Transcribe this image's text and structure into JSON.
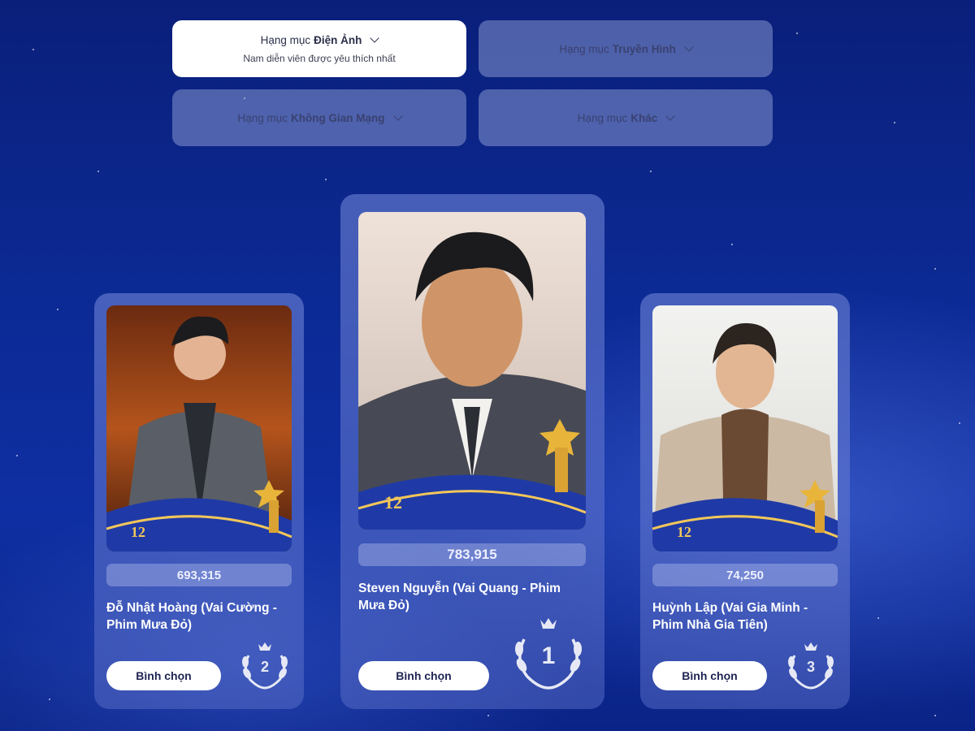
{
  "categories": [
    {
      "prefix": "Hạng mục",
      "name": "Điện Ảnh",
      "subtitle": "Nam diễn viên được yêu thích nhất",
      "active": true
    },
    {
      "prefix": "Hạng mục",
      "name": "Truyền Hình",
      "active": false
    },
    {
      "prefix": "Hạng mục",
      "name": "Không Gian Mạng",
      "active": false
    },
    {
      "prefix": "Hạng mục",
      "name": "Khác",
      "active": false
    }
  ],
  "nominees": [
    {
      "rank": "2",
      "votes": "693,315",
      "name": "Đỗ Nhật Hoàng (Vai Cường - Phim Mưa Đỏ)",
      "vote_label": "Bình chọn"
    },
    {
      "rank": "1",
      "votes": "783,915",
      "name": "Steven Nguyễn (Vai Quang - Phim Mưa Đỏ)",
      "vote_label": "Bình chọn"
    },
    {
      "rank": "3",
      "votes": "74,250",
      "name": "Huỳnh Lập (Vai Gia Minh - Phim Nhà Gia Tiên)",
      "vote_label": "Bình chọn"
    }
  ],
  "badge_text": "12",
  "colors": {
    "accent_gold": "#e8b53a",
    "card_active": "#ffffff",
    "bg_blue": "#0c2a94"
  }
}
